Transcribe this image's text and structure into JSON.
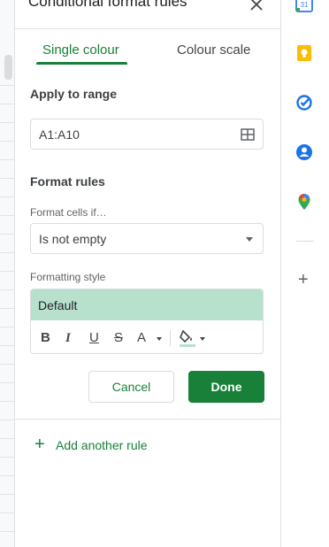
{
  "panel": {
    "title": "Conditional format rules",
    "tabs": [
      {
        "label": "Single colour",
        "active": true
      },
      {
        "label": "Colour scale",
        "active": false
      }
    ],
    "apply_to_range": {
      "label": "Apply to range",
      "value": "A1:A10"
    },
    "format_rules": {
      "label": "Format rules",
      "condition_label": "Format cells if…",
      "condition_value": "Is not empty",
      "style_label": "Formatting style",
      "style_preview": "Default",
      "style_preview_color": "#b7e1cd",
      "toolbar": {
        "bold": "B",
        "italic": "I",
        "underline": "U",
        "strikethrough": "S",
        "text_color": "A"
      }
    },
    "buttons": {
      "cancel": "Cancel",
      "done": "Done"
    },
    "add_rule": {
      "icon": "+",
      "label": "Add another rule"
    }
  },
  "rail": {
    "icons": [
      "calendar-icon",
      "keep-icon",
      "tasks-icon",
      "contacts-icon",
      "maps-icon"
    ],
    "calendar_day": "31",
    "add_icon": "+"
  },
  "colors": {
    "accent": "#188038",
    "preview_fill": "#b7e1cd"
  }
}
